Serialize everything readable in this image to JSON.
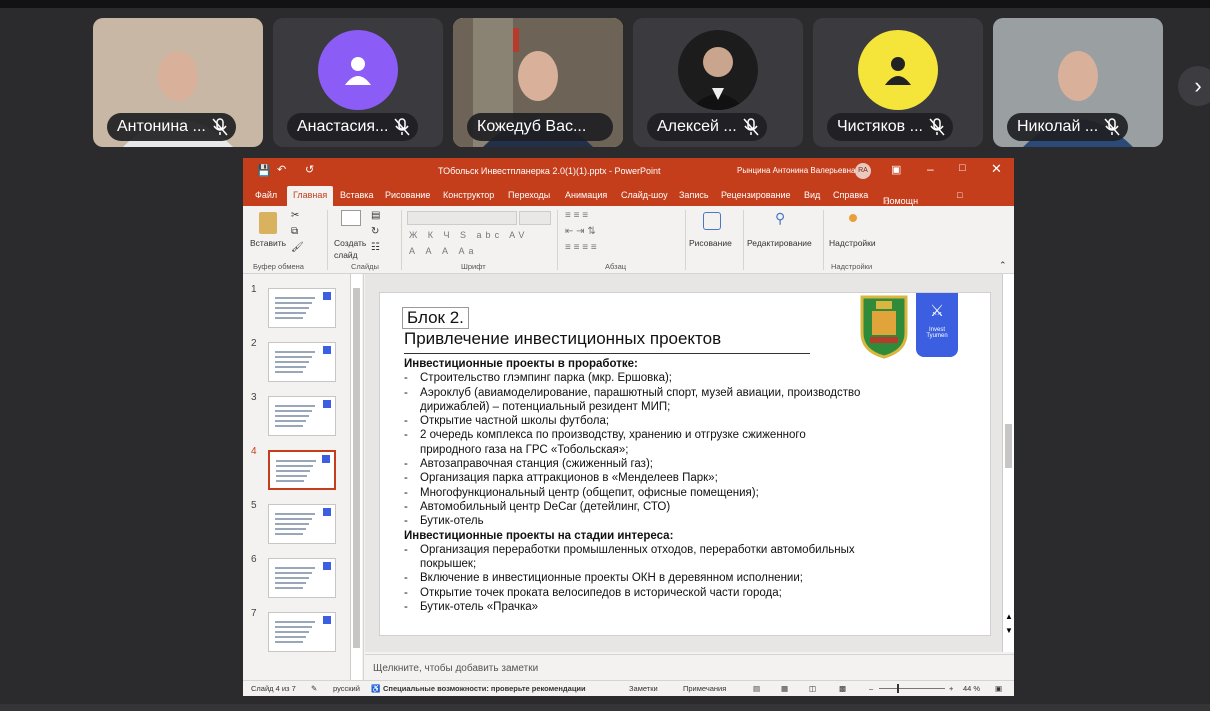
{
  "participants": [
    {
      "name": "Антонина ...",
      "muted": true,
      "type": "video"
    },
    {
      "name": "Анастасия...",
      "muted": true,
      "type": "avatar",
      "color": "#8b5cf6"
    },
    {
      "name": "Кожедуб Вас...",
      "muted": false,
      "type": "video",
      "speaking": true
    },
    {
      "name": "Алексей ...",
      "muted": true,
      "type": "photo"
    },
    {
      "name": "Чистяков ...",
      "muted": true,
      "type": "avatar",
      "color": "#f5e43a"
    },
    {
      "name": "Николай ...",
      "muted": true,
      "type": "video"
    }
  ],
  "next_icon": "chevron-right-icon",
  "powerpoint": {
    "file_title": "ТОбольск Инвестпланерка 2.0(1)(1).pptx  -  PowerPoint",
    "user_name": "Рынцина Антонина Валерьевна",
    "user_initials": "RA",
    "tabs": [
      "Файл",
      "Главная",
      "Вставка",
      "Рисование",
      "Конструктор",
      "Переходы",
      "Анимация",
      "Слайд-шоу",
      "Запись",
      "Рецензирование",
      "Вид",
      "Справка"
    ],
    "selected_tab": "Главная",
    "help_label": "Помощн",
    "ribbon": {
      "paste": "Вставить",
      "new_slide_1": "Создать",
      "new_slide_2": "слайд",
      "drawing": "Рисование",
      "editing": "Редактирование",
      "addins": "Надстройки",
      "groups": {
        "clipboard": "Буфер обмена",
        "slides": "Слайды",
        "font": "Шрифт",
        "paragraph": "Абзац",
        "addins": "Надстройки"
      }
    },
    "slide_numbers": [
      "1",
      "2",
      "3",
      "4",
      "5",
      "6",
      "7"
    ],
    "selected_slide": "4",
    "slide": {
      "block": "Блок 2.",
      "heading": "Привлечение инвестиционных проектов",
      "logo_text_1": "Invest",
      "logo_text_2": "Tyumen",
      "section1": "Инвестиционные проекты в проработке:",
      "items1": [
        "Строительство глэмпинг парка (мкр. Ершовка);",
        "Аэроклуб (авиамоделирование, парашютный спорт, музей авиации, производство дирижаблей) – потенциальный резидент МИП;",
        "Открытие частной школы футбола;",
        "2 очередь комплекса по производству, хранению и отгрузке сжиженного природного газа на ГРС «Тобольская»;",
        "Автозаправочная станция (сжиженный газ);",
        "Организация парка аттракционов в «Менделеев Парк»;",
        "Многофункциональный центр (общепит, офисные помещения);",
        "Автомобильный центр DeCar (детейлинг, СТО)",
        "Бутик-отель"
      ],
      "section2": "Инвестиционные проекты на стадии интереса:",
      "items2": [
        "Организация переработки промышленных отходов, переработки автомобильных покрышек;",
        "Включение в инвестиционные проекты ОКН в деревянном исполнении;",
        "Открытие точек проката велосипедов в исторической части города;",
        "Бутик-отель «Прачка»"
      ]
    },
    "notes_placeholder": "Щелкните, чтобы добавить заметки",
    "status": {
      "slide_info": "Слайд 4 из 7",
      "language": "русский",
      "accessibility": "Специальные возможности: проверьте рекомендации",
      "notes": "Заметки",
      "comments": "Примечания",
      "zoom": "44 %"
    },
    "colors": {
      "accent": "#c43e1c"
    }
  }
}
